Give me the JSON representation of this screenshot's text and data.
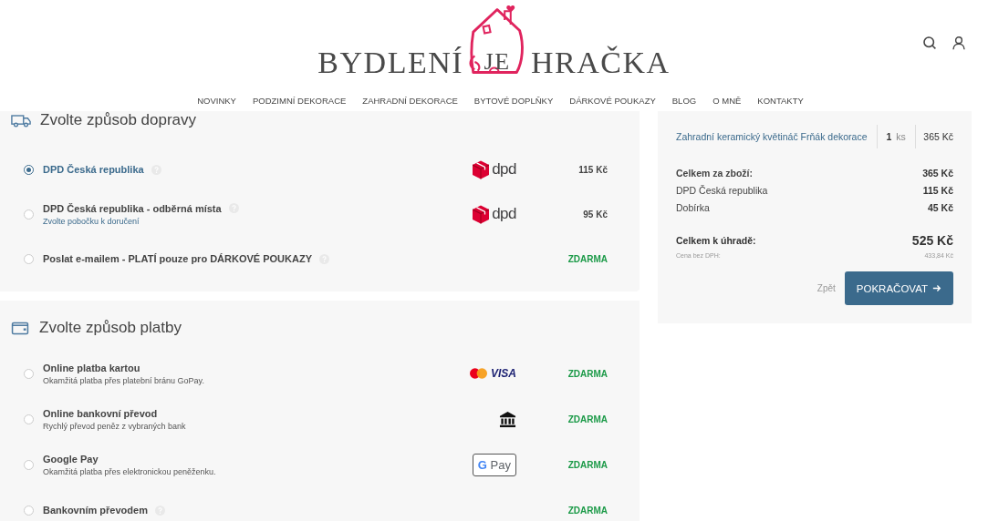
{
  "header": {
    "logo": {
      "left": "BYDLENÍ",
      "middle": "JE",
      "right": "HRAČKA"
    },
    "nav": [
      {
        "label": "NOVINKY"
      },
      {
        "label": "PODZIMNÍ DEKORACE"
      },
      {
        "label": "ZAHRADNÍ DEKORACE"
      },
      {
        "label": "BYTOVÉ DOPLŇKY"
      },
      {
        "label": "DÁRKOVÉ POUKAZY"
      },
      {
        "label": "BLOG"
      },
      {
        "label": "O MNĚ"
      },
      {
        "label": "KONTAKTY"
      }
    ]
  },
  "shipping": {
    "title": "Zvolte způsob dopravy",
    "options": [
      {
        "name": "DPD Česká republika",
        "selected": true,
        "help": true,
        "logo": {
          "kind": "dpd",
          "text": "dpd"
        },
        "price": "115 Kč",
        "free": false
      },
      {
        "name": "DPD Česká republika - odběrná místa",
        "note": "Zvolte pobočku k doručení",
        "selected": false,
        "help": true,
        "logo": {
          "kind": "dpd",
          "text": "dpd"
        },
        "price": "95 Kč",
        "free": false
      },
      {
        "name": "Poslat e-mailem - PLATÍ pouze pro DÁRKOVÉ POUKAZY",
        "selected": false,
        "help": true,
        "price": "ZDARMA",
        "free": true
      }
    ]
  },
  "payment": {
    "title": "Zvolte způsob platby",
    "options": [
      {
        "name": "Online platba kartou",
        "description": "Okamžitá platba přes platební bránu GoPay.",
        "selected": false,
        "help": false,
        "logo": {
          "kind": "cards",
          "text": "VISA"
        },
        "price": "ZDARMA",
        "free": true
      },
      {
        "name": "Online bankovní převod",
        "description": "Rychlý převod peněz z vybraných bank",
        "selected": false,
        "help": false,
        "logo": {
          "kind": "bank"
        },
        "price": "ZDARMA",
        "free": true
      },
      {
        "name": "Google Pay",
        "description": "Okamžitá platba přes elektronickou peněženku.",
        "selected": false,
        "help": false,
        "logo": {
          "kind": "gpay",
          "mark": "G",
          "text": "Pay"
        },
        "price": "ZDARMA",
        "free": true
      },
      {
        "name": "Bankovním převodem",
        "selected": false,
        "help": true,
        "price": "ZDARMA",
        "free": true
      }
    ]
  },
  "summary": {
    "item": {
      "name": "Zahradní keramický květináč Frňák dekorace",
      "qty": "1",
      "unit": "ks",
      "price": "365 Kč"
    },
    "lines": [
      {
        "label": "Celkem za zboží:",
        "value": "365 Kč",
        "bold": true
      },
      {
        "label": "DPD Česká republika",
        "value": "115 Kč",
        "bold": false
      },
      {
        "label": "Dobírka",
        "value": "45 Kč",
        "bold": false
      }
    ],
    "total": {
      "label": "Celkem k úhradě:",
      "value": "525 Kč"
    },
    "net": {
      "label": "Cena bez DPH:",
      "value": "433,84 Kč"
    },
    "back": "Zpět",
    "continue": "POKRAČOVAT"
  }
}
